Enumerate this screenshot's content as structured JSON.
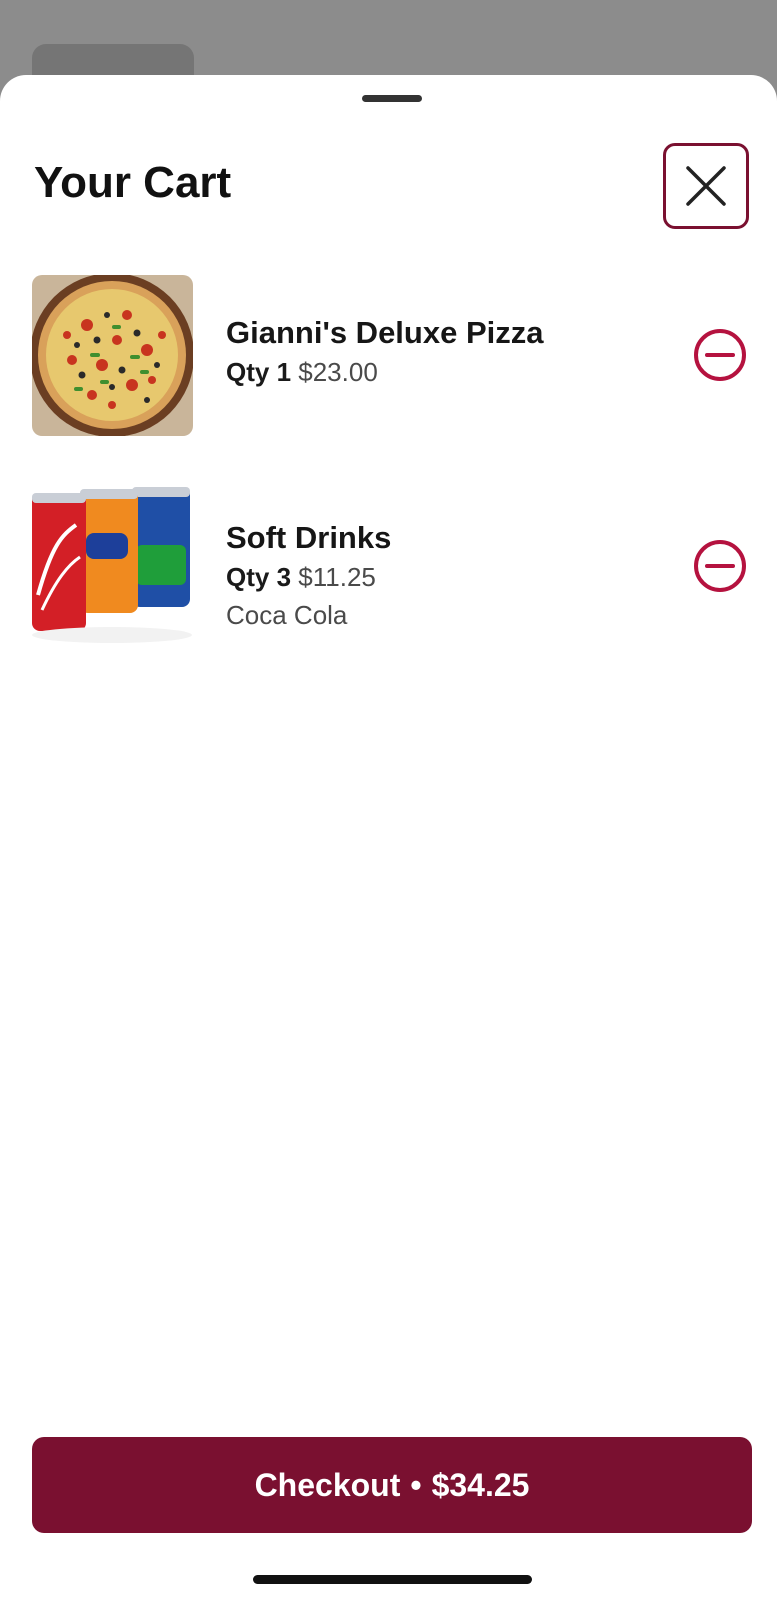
{
  "sheet": {
    "title": "Your Cart"
  },
  "cart": {
    "items": [
      {
        "name": "Gianni's Deluxe Pizza",
        "qty_label": "Qty 1",
        "price": "$23.00",
        "option": "",
        "image_icon": "pizza-image"
      },
      {
        "name": "Soft Drinks",
        "qty_label": "Qty 3",
        "price": "$11.25",
        "option": "Coca Cola",
        "image_icon": "soft-drink-cans-image"
      }
    ]
  },
  "checkout": {
    "label": "Checkout",
    "separator": "•",
    "total": "$34.25"
  },
  "colors": {
    "accent": "#7a1030",
    "backdrop": "#8c8c8c",
    "sheet": "#ffffff"
  },
  "icons": {
    "close": "close-icon",
    "remove": "minus-circle-icon"
  }
}
